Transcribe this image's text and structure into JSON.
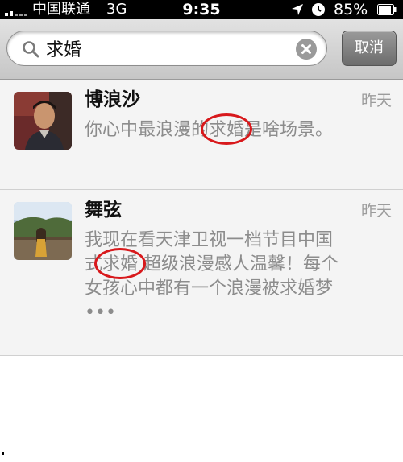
{
  "status_bar": {
    "carrier": "中国联通",
    "network": "3G",
    "time": "9:35",
    "battery_percent": "85%",
    "icons": [
      "signal-icon",
      "location-arrow-icon",
      "alarm-clock-icon",
      "battery-icon"
    ]
  },
  "search": {
    "value": "求婚",
    "cancel_label": "取消",
    "icons": [
      "search-icon",
      "clear-icon"
    ]
  },
  "results": [
    {
      "name": "博浪沙",
      "time": "昨天",
      "snippet_before": "你心中最浪漫的",
      "snippet_match": "求婚",
      "snippet_after": "是啥场景。"
    },
    {
      "name": "舞弦",
      "time": "昨天",
      "snippet_before": "我现在看天津卫视一档节目中国式",
      "snippet_match": "求婚",
      "snippet_after": " 超级浪漫感人温馨！每个女孩心中都有一个浪漫被求婚梦•••"
    }
  ],
  "colors": {
    "highlight_circle": "#d8191c",
    "list_background": "#f4f4f4",
    "timestamp": "#9c9c9c",
    "snippet_text": "#8c8c8c"
  }
}
